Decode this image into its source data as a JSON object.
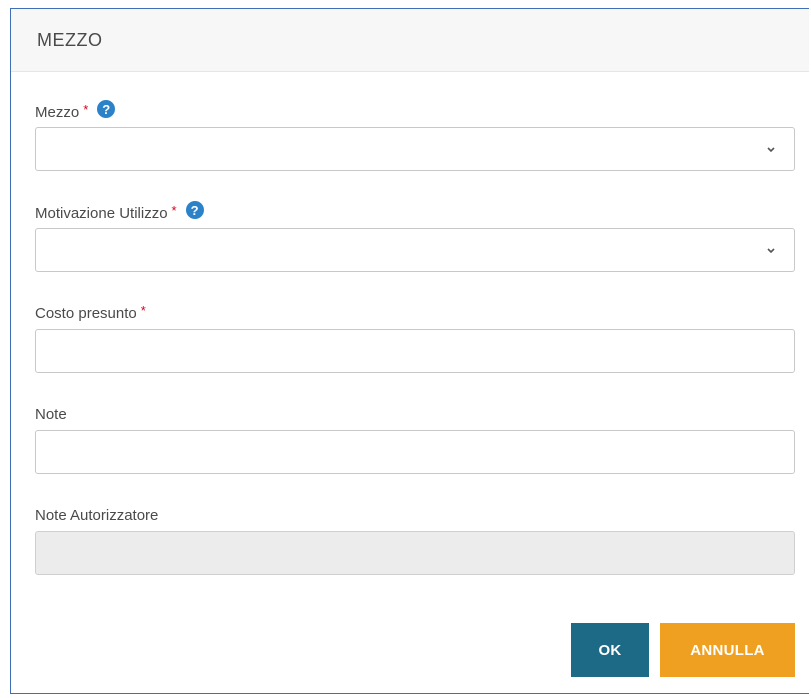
{
  "dialog": {
    "title": "MEZZO"
  },
  "fields": {
    "mezzo": {
      "label": "Mezzo",
      "required_mark": "*",
      "help_glyph": "?",
      "value": ""
    },
    "motivazione": {
      "label": "Motivazione Utilizzo",
      "required_mark": "*",
      "help_glyph": "?",
      "value": ""
    },
    "costo": {
      "label": "Costo presunto",
      "required_mark": "*",
      "value": ""
    },
    "note": {
      "label": "Note",
      "value": ""
    },
    "note_autorizzatore": {
      "label": "Note Autorizzatore",
      "value": ""
    }
  },
  "buttons": {
    "ok_label": "OK",
    "cancel_label": "ANNULLA"
  },
  "colors": {
    "required": "#d0021b",
    "help": "#2c82c9",
    "ok_button": "#1d6a87",
    "cancel_button": "#f0a021",
    "dialog_border": "#3f6fb4"
  },
  "icons": {
    "help": "question-circle-icon",
    "select": "chevron-down-icon"
  }
}
